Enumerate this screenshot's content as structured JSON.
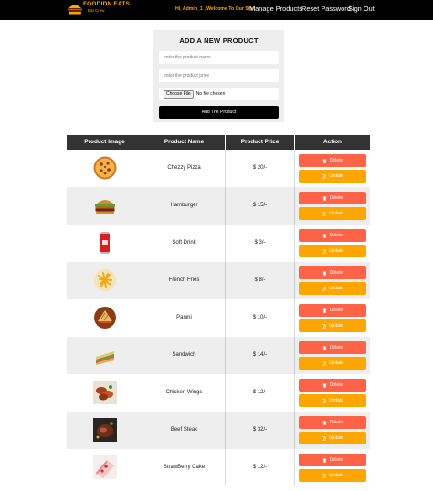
{
  "nav": {
    "brand_line1": "FOODIDN EATS",
    "brand_line2": "Eat Crew",
    "welcome": "Hi, Admin_1 , Welcome To Our Site!",
    "links": [
      "Manage Products",
      "Reset Password",
      "Sign Out"
    ]
  },
  "form": {
    "title": "ADD A NEW PRODUCT",
    "name_placeholder": "enter the product name",
    "price_placeholder": "enter the product price",
    "file_button": "Choose File",
    "file_status": "No file chosen",
    "submit": "Add The Product"
  },
  "table": {
    "headers": [
      "Product Image",
      "Product Name",
      "Product Price",
      "Action"
    ],
    "delete_label": "Delete",
    "update_label": "Update",
    "rows": [
      {
        "name": "Chezzy Pizza",
        "price": "$ 20/-",
        "image": "pizza"
      },
      {
        "name": "Hamburger",
        "price": "$ 15/-",
        "image": "burger"
      },
      {
        "name": "Soft Drink",
        "price": "$ 3/-",
        "image": "soda-can"
      },
      {
        "name": "French Fries",
        "price": "$ 8/-",
        "image": "fries"
      },
      {
        "name": "Panini",
        "price": "$ 10/-",
        "image": "panini"
      },
      {
        "name": "Sandwich",
        "price": "$ 14/-",
        "image": "sandwich"
      },
      {
        "name": "Chicken Wings",
        "price": "$ 12/-",
        "image": "chicken-wings"
      },
      {
        "name": "Beef Steak",
        "price": "$ 32/-",
        "image": "steak"
      },
      {
        "name": "StrawBerry Cake",
        "price": "$ 12/-",
        "image": "cake"
      }
    ]
  },
  "colors": {
    "accent": "#ffa500",
    "delete": "#ff6347",
    "update": "#ffa500",
    "header": "#333333",
    "nav": "#000000"
  }
}
